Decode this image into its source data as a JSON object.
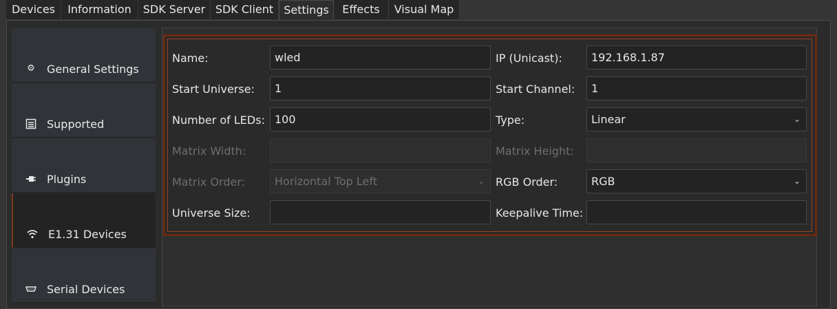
{
  "tabs": [
    "Devices",
    "Information",
    "SDK Server",
    "SDK Client",
    "Settings",
    "Effects",
    "Visual Map"
  ],
  "sidebar": {
    "items": [
      {
        "label": "General Settings",
        "icon": "gear-icon"
      },
      {
        "label": "Supported",
        "icon": "chip-icon"
      },
      {
        "label": "Plugins",
        "icon": "plug-icon"
      },
      {
        "label": "E1.31 Devices",
        "icon": "wifi-icon"
      },
      {
        "label": "Serial Devices",
        "icon": "serial-port-icon"
      }
    ]
  },
  "form": {
    "name_label": "Name:",
    "name_value": "wled",
    "ip_label": "IP (Unicast):",
    "ip_value": "192.168.1.87",
    "start_universe_label": "Start Universe:",
    "start_universe_value": "1",
    "start_channel_label": "Start Channel:",
    "start_channel_value": "1",
    "num_leds_label": "Number of LEDs:",
    "num_leds_value": "100",
    "type_label": "Type:",
    "type_value": "Linear",
    "matrix_width_label": "Matrix Width:",
    "matrix_width_value": "",
    "matrix_height_label": "Matrix Height:",
    "matrix_height_value": "",
    "matrix_order_label": "Matrix Order:",
    "matrix_order_value": "Horizontal Top Left",
    "rgb_order_label": "RGB Order:",
    "rgb_order_value": "RGB",
    "universe_size_label": "Universe Size:",
    "universe_size_value": "",
    "keepalive_label": "Keepalive Time:",
    "keepalive_value": ""
  },
  "colors": {
    "accent": "#a0451f",
    "background": "#2a2a2a"
  }
}
